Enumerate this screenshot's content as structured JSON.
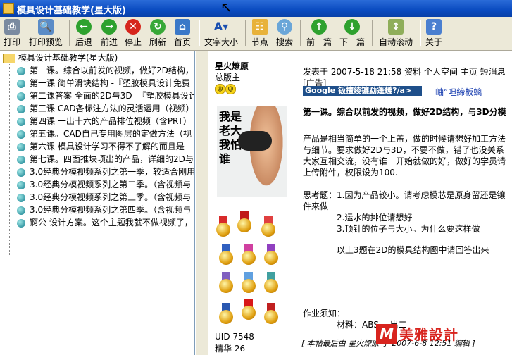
{
  "window": {
    "title": "模具设计基础教学(星大版)"
  },
  "toolbar": {
    "print": "打印",
    "preview": "打印预览",
    "back": "后退",
    "forward": "前进",
    "stop": "停止",
    "refresh": "刷新",
    "home": "首页",
    "font_size": "文字大小",
    "node": "节点",
    "search": "搜索",
    "prev": "前一篇",
    "next": "下一篇",
    "autoscroll": "自动滚动",
    "about": "关于"
  },
  "tree": {
    "root": "模具设计基础教学(星大版)",
    "items": [
      "第一课。综合以前发的视频，做好2D结构，",
      "第一课 简单滑块结构 -『塑胶模具设计免费",
      "第二课答案 全面的2D与3D -『塑胶模具设计",
      "第三课 CAD各标注方法的灵活运用（视频）",
      "第四课 一出十六的产品排位视频（含PRT）",
      "第五课。CAD自己专用图层的定做方法（视",
      "第六课 模具设计学习不得不了解的而且是",
      "第七课。四面推块项出的产品，详细的2D与",
      "3.0经典分模视频系列之第一季，较适合刚用",
      "3.0经典分模视频系列之第二季。（含视频与",
      "3.0经典分模视频系列之第三季。（含视频与",
      "3.0经典分模视频系列之第四季。（含视频与",
      "锕公 设计方案。这个主题我就不做视频了，"
    ]
  },
  "poster": {
    "name": "星火燎原",
    "role": "总版主",
    "avatar_text": "我是老大 我怕谁",
    "uid": "UID 7548",
    "essence": "精华 26"
  },
  "post": {
    "meta": "发表于 2007-5-18 21:58  资料  个人空间  主页 短消息",
    "ad_label": "[广告]",
    "ad_bar": "Google 钣擅绫镳勐蓬蠖?/a>",
    "ad_link": "岫”呾締板螭",
    "title": "第一课。综合以前发的视频，做好2D结构，与3D分模",
    "para1": "产品是相当简单的一个上盖，做的时候请想好加工方法与细节。要求做好2D与3D，不要不做，错了也没关系大家互相交流，没有谁一开始就做的好，做好的学员请上传附件，权限设为100.",
    "q1": "思考题：1.因为产品较小。请考虑模芯是原身留还是镶件来做",
    "q2": "2.运水的排位请想好",
    "q3": "3.顶针的位子与大小。为什么要这样做",
    "note": "以上3题在2D的模具结构图中请回答出来",
    "homework": "作业须知：",
    "material": "材料：ABS       一出二",
    "footer": "[ 本帖最后由 星火燎原 于 2007-6-8 12:51 编辑 ]"
  },
  "watermark": {
    "letter": "M",
    "text": "美雅設計"
  }
}
